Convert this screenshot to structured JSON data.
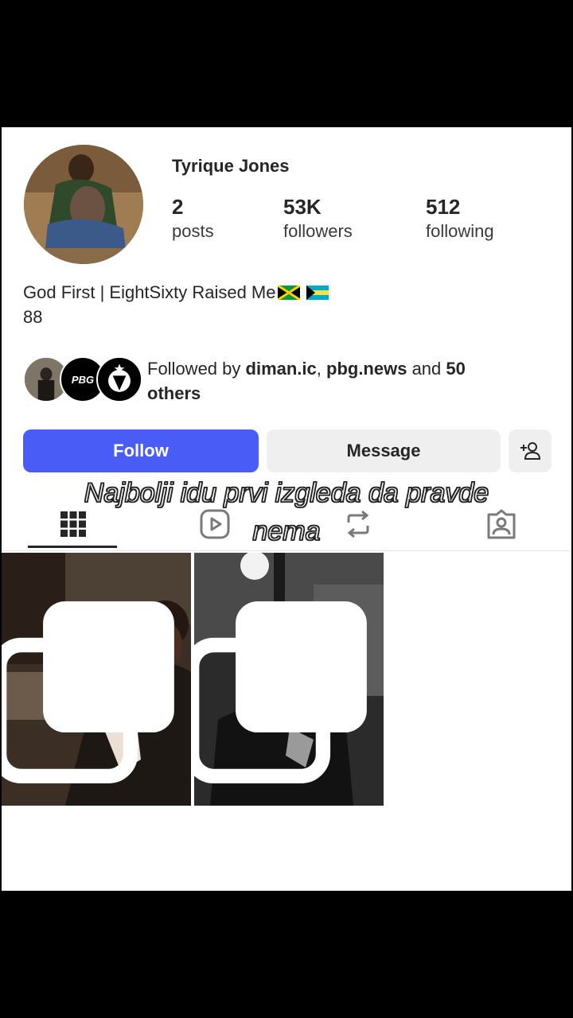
{
  "profile": {
    "username": "Tyrique Jones",
    "stats": [
      {
        "value": "2",
        "label": "posts"
      },
      {
        "value": "53K",
        "label": "followers"
      },
      {
        "value": "512",
        "label": "following"
      }
    ],
    "bio_line1": "God First | EightSixty Raised Me",
    "bio_line2": "88",
    "bio_flags": [
      "jamaica-flag",
      "bahamas-flag"
    ]
  },
  "followed_by": {
    "prefix": "Followed by ",
    "user1": "diman.ic",
    "sep": ", ",
    "user2": "pbg.news",
    "and": " and ",
    "count": "50",
    "suffix": "others",
    "avatar_badge": "PBG"
  },
  "actions": {
    "follow": "Follow",
    "message": "Message",
    "add_icon": "add-person-icon"
  },
  "tabs": [
    "grid-icon",
    "reels-icon",
    "reposts-icon",
    "tagged-icon"
  ],
  "caption_overlay": {
    "line1": "Najbolji idu prvi izgleda da pravde",
    "line2": "nema"
  },
  "posts": [
    {
      "type": "photo",
      "icon": "multi-post-icon"
    },
    {
      "type": "photo",
      "icon": "multi-post-icon"
    }
  ],
  "colors": {
    "follow_button": "#4a5cf6",
    "secondary_button": "#efefef",
    "text": "#262626"
  }
}
